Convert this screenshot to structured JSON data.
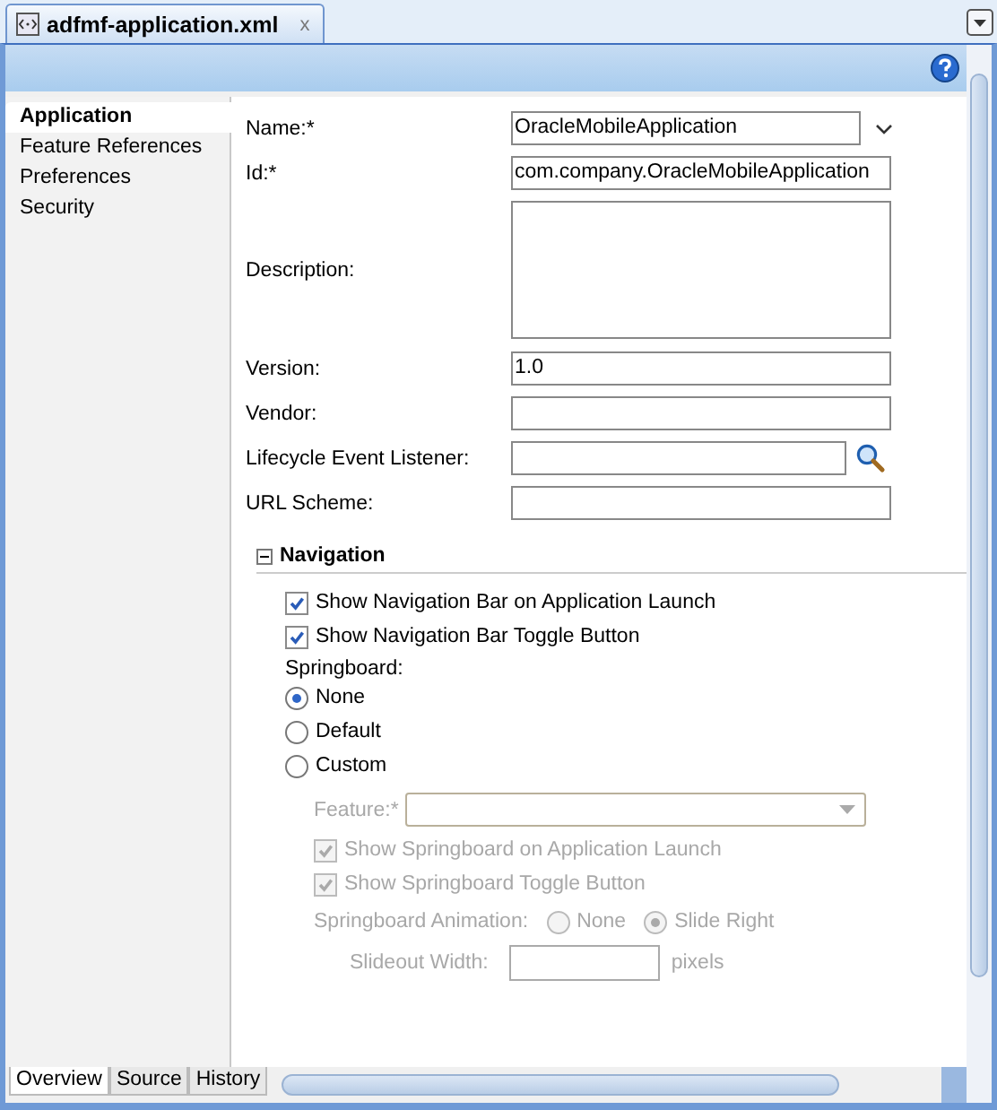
{
  "editor_tab": {
    "title": "adfmf-application.xml",
    "close": "x"
  },
  "sidebar": {
    "items": [
      {
        "label": "Application",
        "selected": true
      },
      {
        "label": "Feature References",
        "selected": false
      },
      {
        "label": "Preferences",
        "selected": false
      },
      {
        "label": "Security",
        "selected": false
      }
    ]
  },
  "form": {
    "fields": [
      {
        "kind": "combo",
        "label": "Name:*",
        "value": "OracleMobileApplication"
      },
      {
        "kind": "text",
        "label": "Id:*",
        "value": "com.company.OracleMobileApplication"
      },
      {
        "kind": "textarea",
        "label": "Description:"
      },
      {
        "kind": "text",
        "label": "Version:",
        "value": "1.0"
      },
      {
        "kind": "text",
        "label": "Vendor:"
      },
      {
        "kind": "lookup",
        "label": "Lifecycle Event Listener:"
      },
      {
        "kind": "text",
        "label": "URL Scheme:"
      }
    ]
  },
  "navigation": {
    "title": "Navigation",
    "expanded": true,
    "checkboxes": [
      {
        "label": "Show Navigation Bar on Application Launch",
        "checked": true
      },
      {
        "label": "Show Navigation Bar Toggle Button",
        "checked": true
      }
    ],
    "springboard_label": "Springboard:",
    "springboard_options": [
      {
        "label": "None",
        "selected": true
      },
      {
        "label": "Default",
        "selected": false
      },
      {
        "label": "Custom",
        "selected": false
      }
    ],
    "feature": {
      "label": "Feature:*",
      "disabled": true
    },
    "springboard_checkboxes": [
      {
        "label": "Show Springboard on Application Launch",
        "checked": true,
        "disabled": true
      },
      {
        "label": "Show Springboard Toggle Button",
        "checked": true,
        "disabled": true
      }
    ],
    "animation": {
      "label": "Springboard Animation:",
      "options": [
        {
          "label": "None",
          "selected": false
        },
        {
          "label": "Slide Right",
          "selected": true
        }
      ]
    },
    "slideout": {
      "label": "Slideout Width:",
      "units": "pixels"
    }
  },
  "bottom_tabs": [
    {
      "label": "Overview",
      "selected": true
    },
    {
      "label": "Source",
      "selected": false
    },
    {
      "label": "History",
      "selected": false
    }
  ]
}
